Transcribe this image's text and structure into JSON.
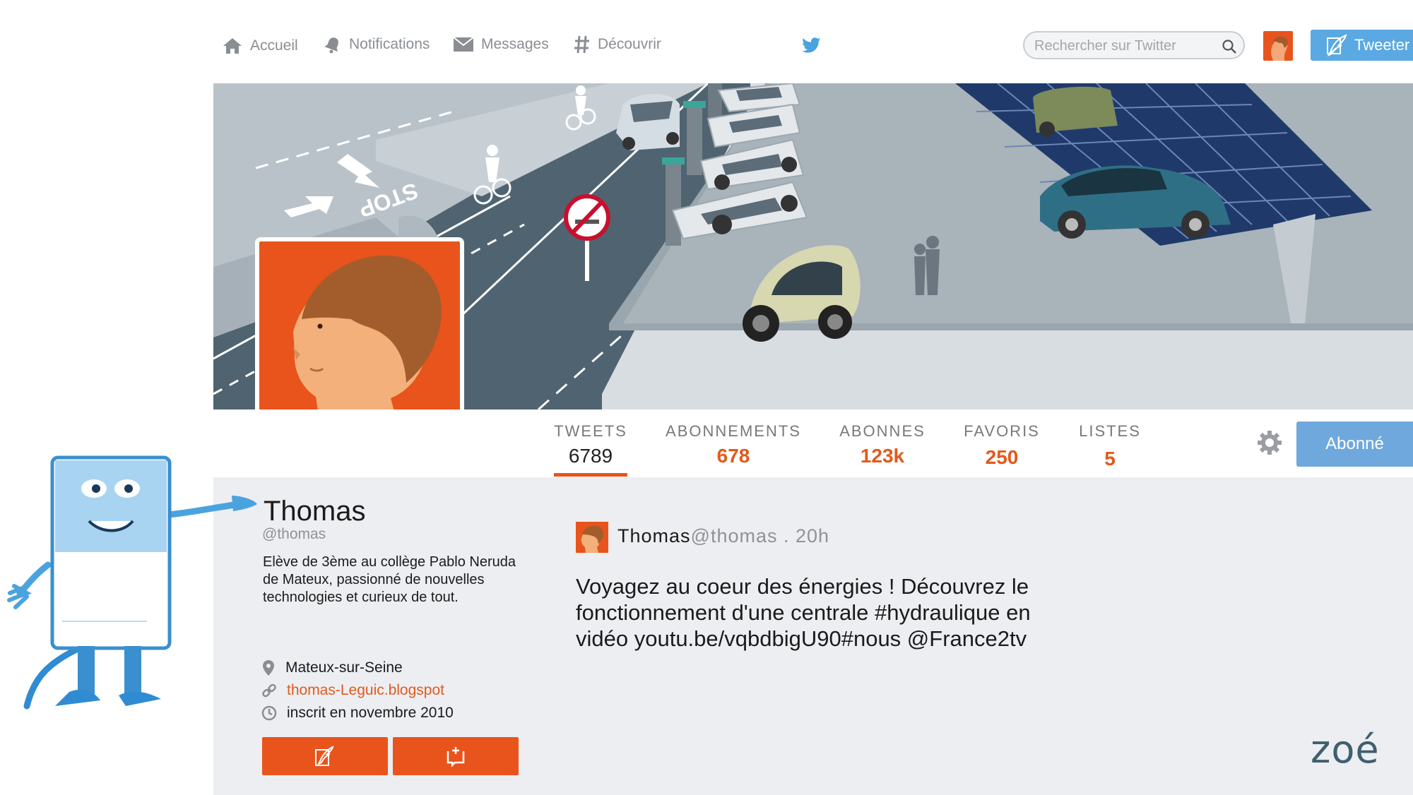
{
  "nav": {
    "home": "Accueil",
    "notifications": "Notifications",
    "messages": "Messages",
    "discover": "Découvrir"
  },
  "search": {
    "placeholder": "Rechercher sur Twitter"
  },
  "tweet_button": "Tweeter",
  "stats": [
    {
      "label": "TWEETS",
      "value": "6789"
    },
    {
      "label": "ABONNEMENTS",
      "value": "678"
    },
    {
      "label": "ABONNES",
      "value": "123k"
    },
    {
      "label": "FAVORIS",
      "value": "250"
    },
    {
      "label": "LISTES",
      "value": "5"
    }
  ],
  "follow_button": "Abonné",
  "profile": {
    "name": "Thomas",
    "handle": "@thomas",
    "bio": "Elève de 3ème au collège Pablo Neruda de Mateux, passionné de nouvelles technologies et curieux de tout.",
    "location": "Mateux-sur-Seine",
    "website": "thomas-Leguic.blogspot",
    "joined": "inscrit en novembre 2010"
  },
  "tweet": {
    "name": "Thomas",
    "handle": "@thomas",
    "time": " . 20h",
    "text": "Voyagez au coeur des énergies ! Découvrez le fonctionnement d'une centrale #hydraulique en vidéo youtu.be/vqbdbigU90#nous @France2tv"
  },
  "signature": "zoé",
  "colors": {
    "accent": "#e8541c",
    "twitter_blue": "#5aa9e2",
    "follow_blue": "#6fa8dc",
    "banner_road": "#4f6470"
  },
  "icons": [
    "home-icon",
    "bell-icon",
    "envelope-icon",
    "hash-icon",
    "twitter-bird-icon",
    "search-icon",
    "quill-icon",
    "gear-icon",
    "location-pin-icon",
    "link-icon",
    "clock-icon",
    "compose-icon",
    "message-icon",
    "no-smoke-sign-icon"
  ]
}
